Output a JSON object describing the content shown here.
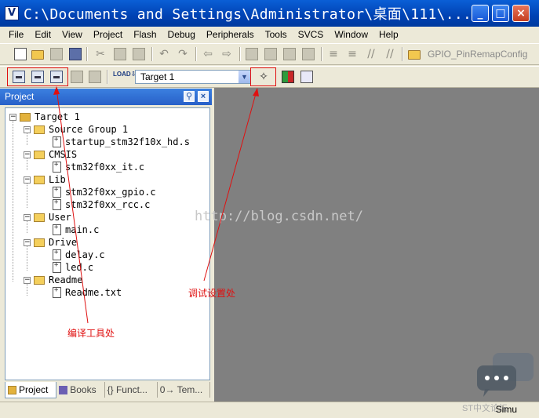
{
  "window": {
    "title": "C:\\Documents and Settings\\Administrator\\桌面\\111\\...",
    "icon_letter": "V",
    "controls": [
      "_",
      "□",
      "×"
    ]
  },
  "menu": [
    "File",
    "Edit",
    "View",
    "Project",
    "Flash",
    "Debug",
    "Peripherals",
    "Tools",
    "SVCS",
    "Window",
    "Help"
  ],
  "toolbar": {
    "find_text": "GPIO_PinRemapConfig",
    "target_name": "Target 1",
    "load_label": "LOAD"
  },
  "project_panel": {
    "title": "Project",
    "tree": {
      "target": "Target 1",
      "groups": [
        {
          "name": "Source Group 1",
          "files": [
            "startup_stm32f10x_hd.s"
          ]
        },
        {
          "name": "CMSIS",
          "files": [
            "stm32f0xx_it.c"
          ]
        },
        {
          "name": "Lib",
          "files": [
            "stm32f0xx_gpio.c",
            "stm32f0xx_rcc.c"
          ]
        },
        {
          "name": "User",
          "files": [
            "main.c"
          ]
        },
        {
          "name": "Drive",
          "files": [
            "delay.c",
            "led.c"
          ]
        },
        {
          "name": "Readme",
          "files": [
            "Readme.txt"
          ]
        }
      ]
    },
    "tabs": [
      "Project",
      "Books",
      "{} Funct...",
      "0→ Tem..."
    ]
  },
  "annotations": {
    "compile_tools": "编译工具处",
    "debug_settings": "调试设置处"
  },
  "watermark": "http://blog.csdn.net/",
  "status": {
    "mode": "Simu",
    "logo_text": "ST中文论坛"
  }
}
